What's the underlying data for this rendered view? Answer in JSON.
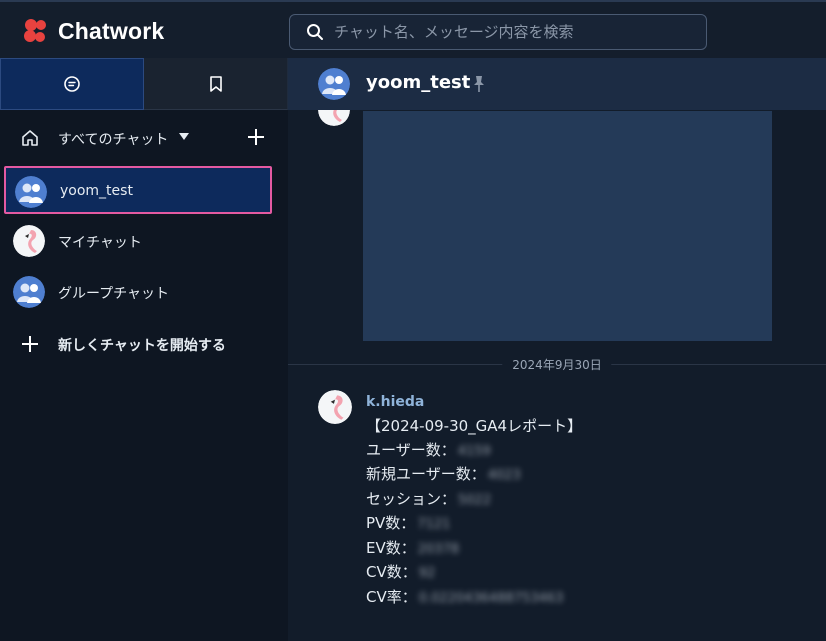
{
  "header": {
    "logo_text": "Chatwork",
    "search_placeholder": "チャット名、メッセージ内容を検索"
  },
  "sidebar": {
    "filter_label": "すべてのチャット",
    "chats": [
      {
        "name": "yoom_test",
        "avatar": "group-avatar",
        "selected": true
      },
      {
        "name": "マイチャット",
        "avatar": "flamingo-avatar",
        "selected": false
      },
      {
        "name": "グループチャット",
        "avatar": "group-avatar",
        "selected": false
      }
    ],
    "new_chat_label": "新しくチャットを開始する"
  },
  "room": {
    "title": "yoom_test"
  },
  "date_separator": "2024年9月30日",
  "message": {
    "sender": "k.hieda",
    "lines": [
      {
        "label": "【2024-09-30_GA4レポート】",
        "value": ""
      },
      {
        "label": "ユーザー数：",
        "value": "4159"
      },
      {
        "label": "新規ユーザー数：",
        "value": "4023"
      },
      {
        "label": "セッション：",
        "value": "5022"
      },
      {
        "label": "PV数：",
        "value": "7121"
      },
      {
        "label": "EV数：",
        "value": "20378"
      },
      {
        "label": "CV数：",
        "value": "92"
      },
      {
        "label": "CV率：",
        "value": "0.0220436488753463"
      }
    ]
  },
  "colors": {
    "accent": "#e8423f",
    "selected_border": "#e45aa2",
    "selected_bg": "#0d2a5c",
    "sender": "#8fb3d9"
  }
}
